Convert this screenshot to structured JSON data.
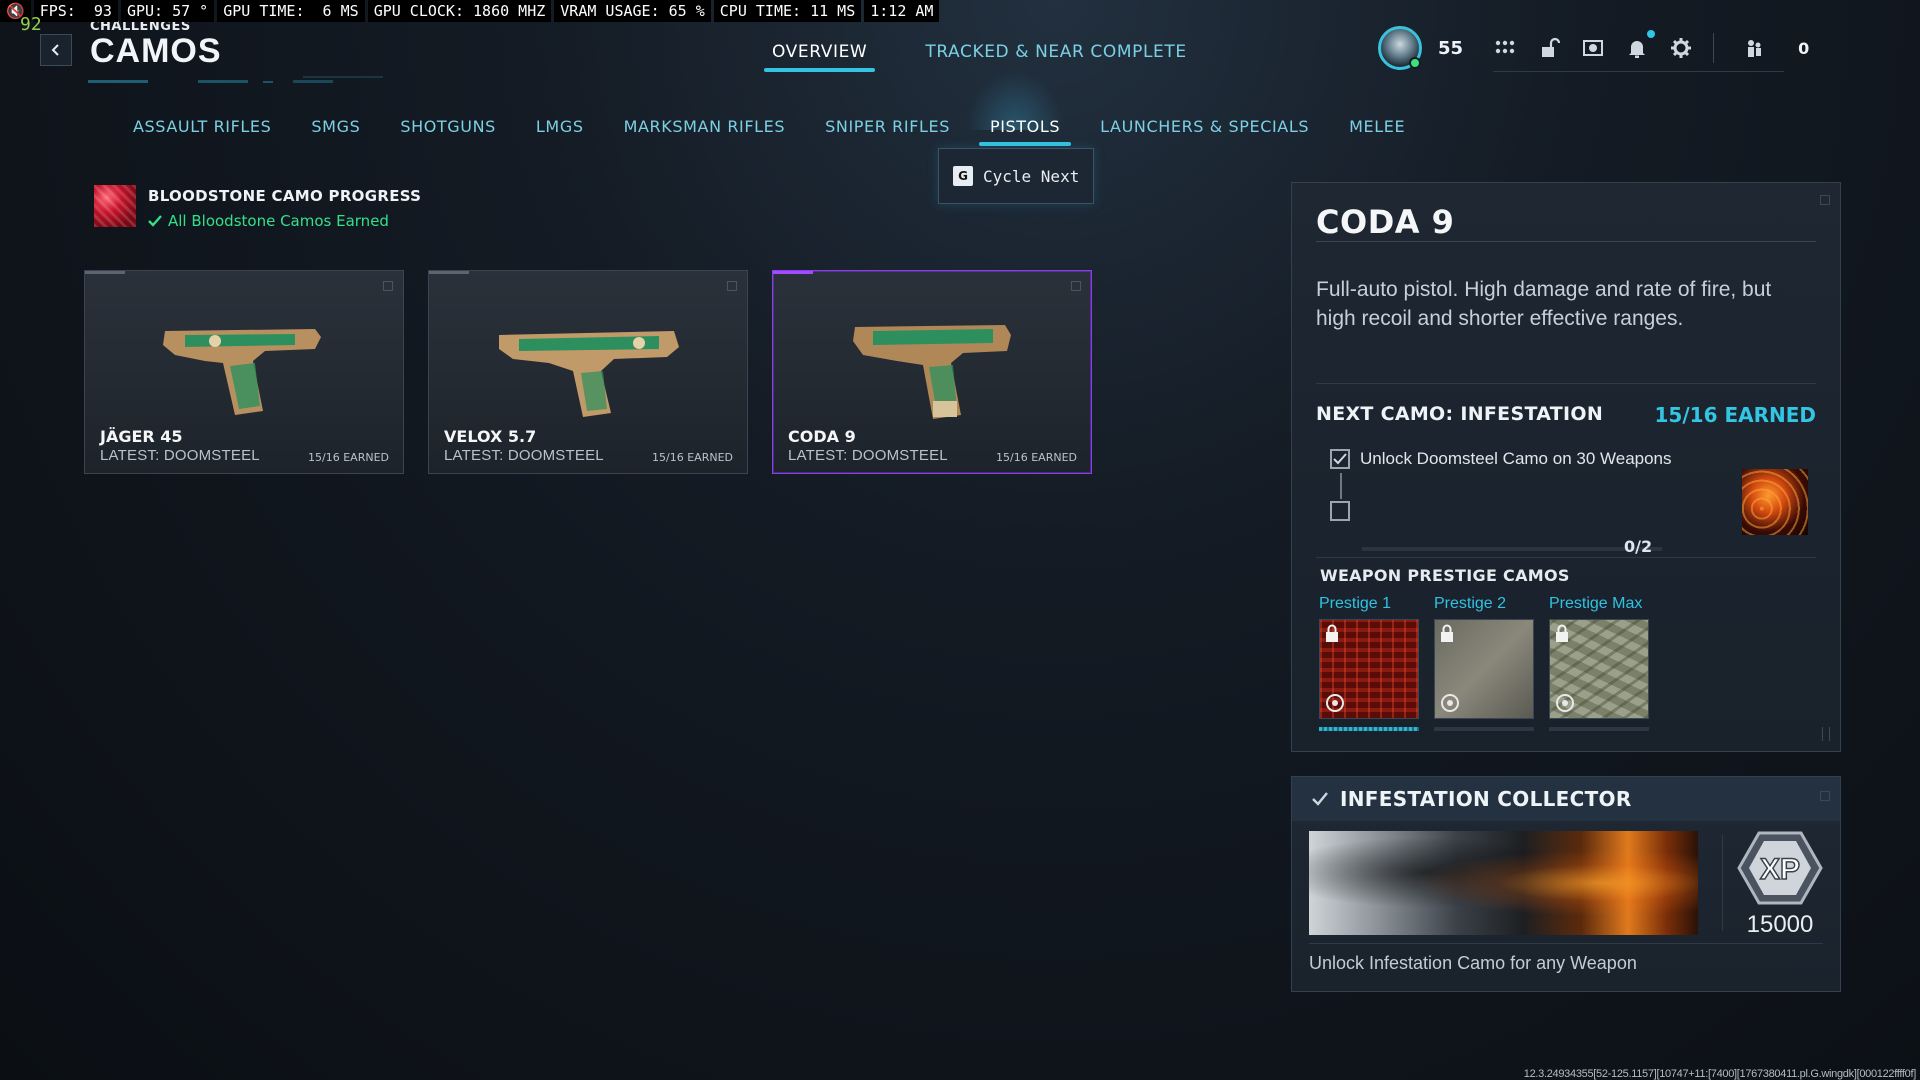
{
  "perf": {
    "fps": "FPS:  93",
    "gpu": "GPU: 57 °",
    "gpu_time": "GPU TIME:  6 MS",
    "gpu_clock": "GPU CLOCK: 1860 MHZ",
    "vram": "VRAM USAGE: 65 %",
    "cpu_time": "CPU TIME: 11 MS",
    "clock": "1:12 AM",
    "fps_counter": "92"
  },
  "header": {
    "breadcrumb": "CHALLENGES",
    "title": "CAMOS",
    "tabs": [
      {
        "label": "OVERVIEW",
        "active": true
      },
      {
        "label": "TRACKED & NEAR COMPLETE",
        "active": false
      }
    ]
  },
  "hud": {
    "level": "55",
    "count": "0",
    "icons": [
      "grid-icon",
      "unlock-icon",
      "screenshot-icon",
      "bell-icon",
      "gear-icon",
      "party-icon"
    ]
  },
  "categories": [
    {
      "label": "ASSAULT RIFLES",
      "active": false
    },
    {
      "label": "SMGS",
      "active": false
    },
    {
      "label": "SHOTGUNS",
      "active": false
    },
    {
      "label": "LMGS",
      "active": false
    },
    {
      "label": "MARKSMAN RIFLES",
      "active": false
    },
    {
      "label": "SNIPER RIFLES",
      "active": false
    },
    {
      "label": "PISTOLS",
      "active": true
    },
    {
      "label": "LAUNCHERS & SPECIALS",
      "active": false
    },
    {
      "label": "MELEE",
      "active": false
    }
  ],
  "cycle": {
    "key": "G",
    "label": "Cycle Next"
  },
  "bloodstone": {
    "title": "BLOODSTONE CAMO PROGRESS",
    "status": "All Bloodstone Camos Earned"
  },
  "weapons": [
    {
      "name": "JÄGER 45",
      "latest": "LATEST: DOOMSTEEL",
      "earned": "15/16 EARNED",
      "selected": false
    },
    {
      "name": "VELOX 5.7",
      "latest": "LATEST: DOOMSTEEL",
      "earned": "15/16 EARNED",
      "selected": false
    },
    {
      "name": "CODA 9",
      "latest": "LATEST: DOOMSTEEL",
      "earned": "15/16 EARNED",
      "selected": true
    }
  ],
  "detail": {
    "title": "CODA 9",
    "description": "Full-auto pistol. High damage and rate of fire, but high recoil and shorter effective ranges.",
    "next_camo": "NEXT CAMO: INFESTATION",
    "next_earned": "15/16 EARNED",
    "task": "Unlock Doomsteel Camo on 30 Weapons",
    "task_done": true,
    "progress": "0/2",
    "progress_fraction": 0,
    "prestige_title": "WEAPON PRESTIGE CAMOS",
    "prestige": [
      {
        "label": "Prestige 1",
        "locked": true,
        "progress": 1
      },
      {
        "label": "Prestige 2",
        "locked": true,
        "progress": 0
      },
      {
        "label": "Prestige Max",
        "locked": true,
        "progress": 0
      }
    ]
  },
  "collector": {
    "title": "INFESTATION COLLECTOR",
    "xp_label": "XP",
    "xp_amount": "15000",
    "description": "Unlock Infestation Camo for any Weapon"
  },
  "build": "12.3.24934355[52-125.1157][10747+11:[7400][1767380411.pl.G.wingdk][000122ffff0f]",
  "colors": {
    "accent": "#34c4e0",
    "selected_card": "#8a3df0",
    "earned_green": "#33e08a"
  }
}
